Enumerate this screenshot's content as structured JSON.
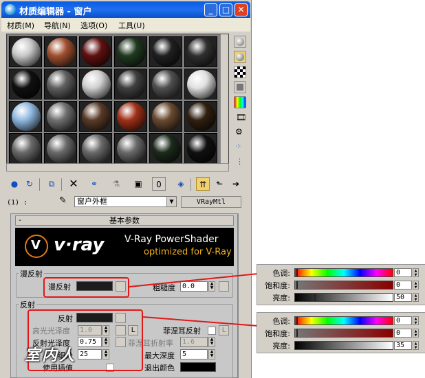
{
  "window": {
    "title": "材质编辑器 - 窗户",
    "min_label": "_",
    "max_label": "□",
    "close_label": "✕"
  },
  "menu": [
    "材质(M)",
    "导航(N)",
    "选项(O)",
    "工具(U)"
  ],
  "slot_colors": [
    [
      "#c8c8c8",
      "#a05030",
      "#601010",
      "#203a20",
      "#202020",
      "#303030"
    ],
    [
      "#101010",
      "#606060",
      "#d0d0d0",
      "#404040",
      "#505050",
      "#e0e0e0"
    ],
    [
      "#90b8e0",
      "#707070",
      "#5a3a28",
      "#a03018",
      "#6a4a30",
      "#302010"
    ],
    [
      "#6a6a6a",
      "#6a6a6a",
      "#6a6a6a",
      "#6a6a6a",
      "#1c2a1c",
      "#101010"
    ]
  ],
  "material": {
    "slot_label": "(1) :",
    "name": "窗户外框",
    "type": "VRayMtl"
  },
  "rollout_title": "基本参数",
  "banner": {
    "logo": "v·ray",
    "line1": "V-Ray PowerShader",
    "line2": "optimized for V-Ray"
  },
  "diffuse": {
    "group_label": "漫反射",
    "diffuse_label": "漫反射",
    "roughness_label": "粗糙度",
    "roughness_value": "0.0"
  },
  "reflection": {
    "group_label": "反射",
    "reflect_label": "反射",
    "hilight_gloss_label": "高光光泽度",
    "hilight_gloss_value": "1.0",
    "l_label": "L",
    "fresnel_label": "菲涅耳反射",
    "fresnel_l_label": "L",
    "refl_gloss_label": "反射光泽度",
    "refl_gloss_value": "0.75",
    "fresnel_ior_label": "菲涅耳折射率",
    "fresnel_ior_value": "1.6",
    "subdivs_label": "细分",
    "subdivs_value": "25",
    "max_depth_label": "最大深度",
    "max_depth_value": "5",
    "interp_label": "使用插值",
    "exit_color_label": "退出颜色"
  },
  "popup1": {
    "hue_label": "色调:",
    "hue_value": "0",
    "sat_label": "饱和度:",
    "sat_value": "0",
    "val_label": "亮度:",
    "val_value": "50",
    "val_fraction": 0.2
  },
  "popup2": {
    "hue_label": "色调:",
    "hue_value": "0",
    "sat_label": "饱和度:",
    "sat_value": "0",
    "val_label": "亮度:",
    "val_value": "35",
    "val_fraction": 0.14
  },
  "watermark": "室内人"
}
